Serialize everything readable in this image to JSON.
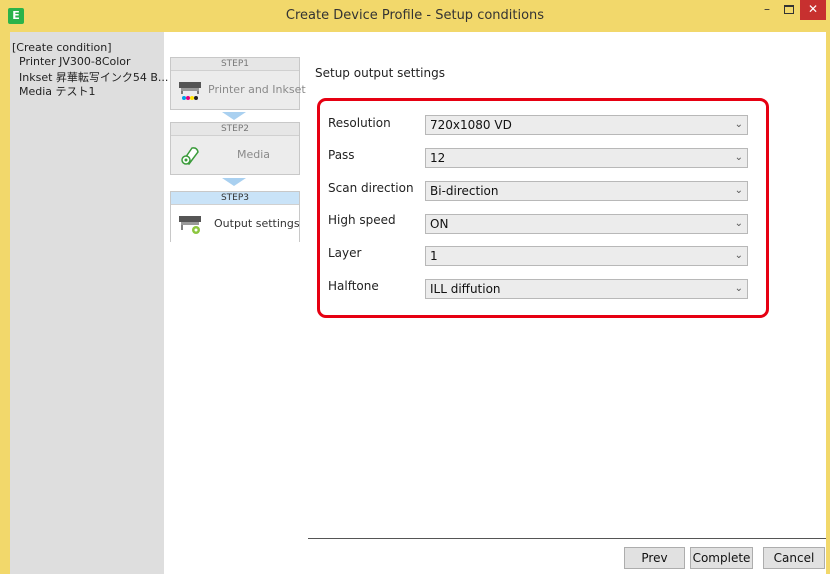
{
  "window": {
    "app_icon_glyph": "E",
    "title": "Create Device Profile - Setup conditions",
    "minimize_glyph": "–",
    "close_glyph": "✕"
  },
  "info_panel": {
    "heading": "[Create condition]",
    "lines": [
      "Printer JV300-8Color",
      "Inkset 昇華転写インク54 B...",
      "Media テスト1"
    ]
  },
  "steps": [
    {
      "header": "STEP1",
      "label": "Printer and Inkset",
      "icon": "printer-inkset-icon",
      "active": false
    },
    {
      "header": "STEP2",
      "label": "Media",
      "icon": "media-roll-icon",
      "active": false
    },
    {
      "header": "STEP3",
      "label": "Output settings",
      "icon": "printer-gear-icon",
      "active": true
    }
  ],
  "main": {
    "heading": "Setup output settings",
    "settings": [
      {
        "label": "Resolution",
        "value": "720x1080 VD"
      },
      {
        "label": "Pass",
        "value": "12"
      },
      {
        "label": "Scan direction",
        "value": "Bi-direction"
      },
      {
        "label": "High speed",
        "value": "ON"
      },
      {
        "label": "Layer",
        "value": "1"
      },
      {
        "label": "Halftone",
        "value": "ILL diffution"
      }
    ]
  },
  "buttons": {
    "prev": "Prev",
    "complete": "Complete",
    "cancel": "Cancel"
  },
  "colors": {
    "title_bar": "#f2d86b",
    "highlight_box": "#e60012",
    "active_step": "#c9e3f8",
    "close_button": "#c7302f"
  }
}
